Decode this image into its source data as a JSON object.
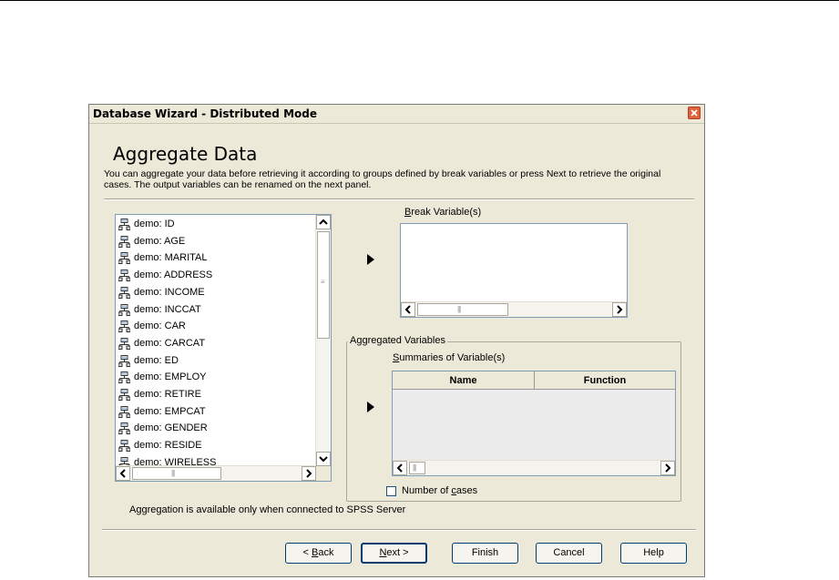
{
  "dialog": {
    "title": "Database Wizard - Distributed Mode",
    "heading": "Aggregate Data",
    "description": "You can aggregate your data before retrieving it according to groups defined by break variables or press Next to retrieve the original cases. The output variables can be renamed on the next panel."
  },
  "variables": {
    "items": [
      "demo: ID",
      "demo: AGE",
      "demo: MARITAL",
      "demo: ADDRESS",
      "demo: INCOME",
      "demo: INCCAT",
      "demo: CAR",
      "demo: CARCAT",
      "demo: ED",
      "demo: EMPLOY",
      "demo: RETIRE",
      "demo: EMPCAT",
      "demo: GENDER",
      "demo: RESIDE",
      "demo: WIRELESS"
    ],
    "icon": "variable-nominal-icon"
  },
  "break_variables": {
    "label_key": "B",
    "label_rest": "reak Variable(s)"
  },
  "aggregated": {
    "group_label": "Aggregated Variables",
    "summaries_key": "S",
    "summaries_rest": "ummaries of Variable(s)",
    "columns": [
      "Name",
      "Function"
    ]
  },
  "number_of_cases": {
    "label_pre": "Number of ",
    "label_key": "c",
    "label_post": "ases",
    "checked": false
  },
  "note": "Aggregation is available only when connected to SPSS Server",
  "buttons": {
    "back_pre": "< ",
    "back_key": "B",
    "back_post": "ack",
    "next_key": "N",
    "next_post": "ext >",
    "finish": "Finish",
    "cancel": "Cancel",
    "help": "Help"
  },
  "colors": {
    "close_button": "#e0613b",
    "input_border": "#7f9db9",
    "dialog_bg": "#ece9d8"
  }
}
